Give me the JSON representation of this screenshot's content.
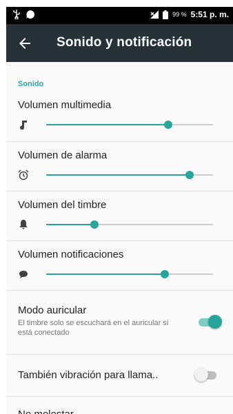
{
  "status_bar": {
    "battery_percent": "99 %",
    "time": "5:51 p. m.",
    "icons": [
      "usb-icon",
      "notification-icon",
      "no-signal-icon",
      "battery-icon"
    ]
  },
  "toolbar": {
    "title": "Sonido y notificación",
    "back_icon": "arrow-back-icon"
  },
  "section": {
    "header": "Sonido"
  },
  "volumes": [
    {
      "label": "Volumen multimedia",
      "icon": "music-note-icon",
      "level": 0.73
    },
    {
      "label": "Volumen de alarma",
      "icon": "alarm-clock-icon",
      "level": 0.86
    },
    {
      "label": "Volumen del timbre",
      "icon": "bell-icon",
      "level": 0.29
    },
    {
      "label": "Volumen notificaciones",
      "icon": "chat-bubble-icon",
      "level": 0.71
    }
  ],
  "modo_auricular": {
    "title": "Modo auricular",
    "summary": "El timbre solo se escuchará en el auricular si está conectado",
    "enabled": true
  },
  "vibracion": {
    "title": "También vibración para llama..",
    "enabled": false
  },
  "no_molestar": {
    "title": "No molestar"
  },
  "colors": {
    "accent": "#26a69a",
    "toolbar": "#263238",
    "status_bar": "#000000"
  }
}
